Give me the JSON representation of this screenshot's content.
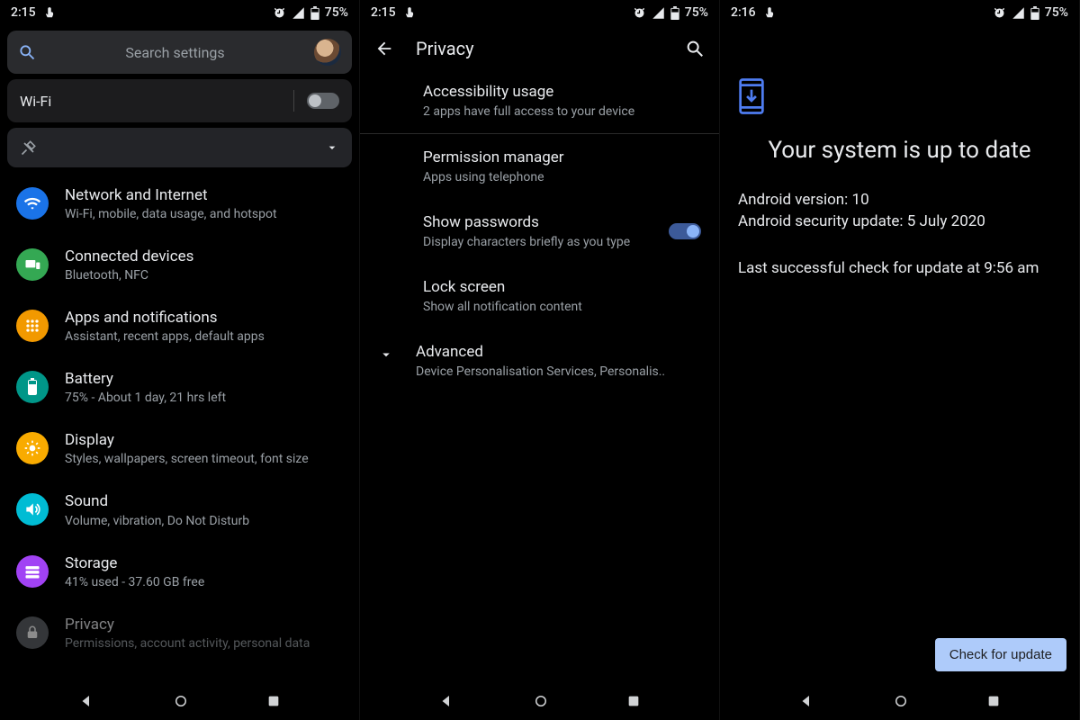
{
  "status": {
    "time_a": "2:15",
    "time_b": "2:15",
    "time_c": "2:16",
    "battery": "75%"
  },
  "panel1": {
    "search_placeholder": "Search settings",
    "wifi_label": "Wi-Fi",
    "items": [
      {
        "title": "Network and Internet",
        "sub": "Wi-Fi, mobile, data usage, and hotspot"
      },
      {
        "title": "Connected devices",
        "sub": "Bluetooth, NFC"
      },
      {
        "title": "Apps and notifications",
        "sub": "Assistant, recent apps, default apps"
      },
      {
        "title": "Battery",
        "sub": "75% - About 1 day, 21 hrs left"
      },
      {
        "title": "Display",
        "sub": "Styles, wallpapers, screen timeout, font size"
      },
      {
        "title": "Sound",
        "sub": "Volume, vibration, Do Not Disturb"
      },
      {
        "title": "Storage",
        "sub": "41% used - 37.60 GB free"
      },
      {
        "title": "Privacy",
        "sub": "Permissions, account activity, personal data"
      }
    ]
  },
  "panel2": {
    "title": "Privacy",
    "items": {
      "accessibility": {
        "title": "Accessibility usage",
        "sub": "2 apps have full access to your device"
      },
      "permission": {
        "title": "Permission manager",
        "sub": "Apps using telephone"
      },
      "passwords": {
        "title": "Show passwords",
        "sub": "Display characters briefly as you type"
      },
      "lock": {
        "title": "Lock screen",
        "sub": "Show all notification content"
      },
      "advanced": {
        "title": "Advanced",
        "sub": "Device Personalisation Services, Personalis.."
      }
    }
  },
  "panel3": {
    "headline": "Your system is up to date",
    "android_version": "Android version: 10",
    "security_update": "Android security update: 5 July 2020",
    "last_check": "Last successful check for update at 9:56 am",
    "cta": "Check for update"
  }
}
